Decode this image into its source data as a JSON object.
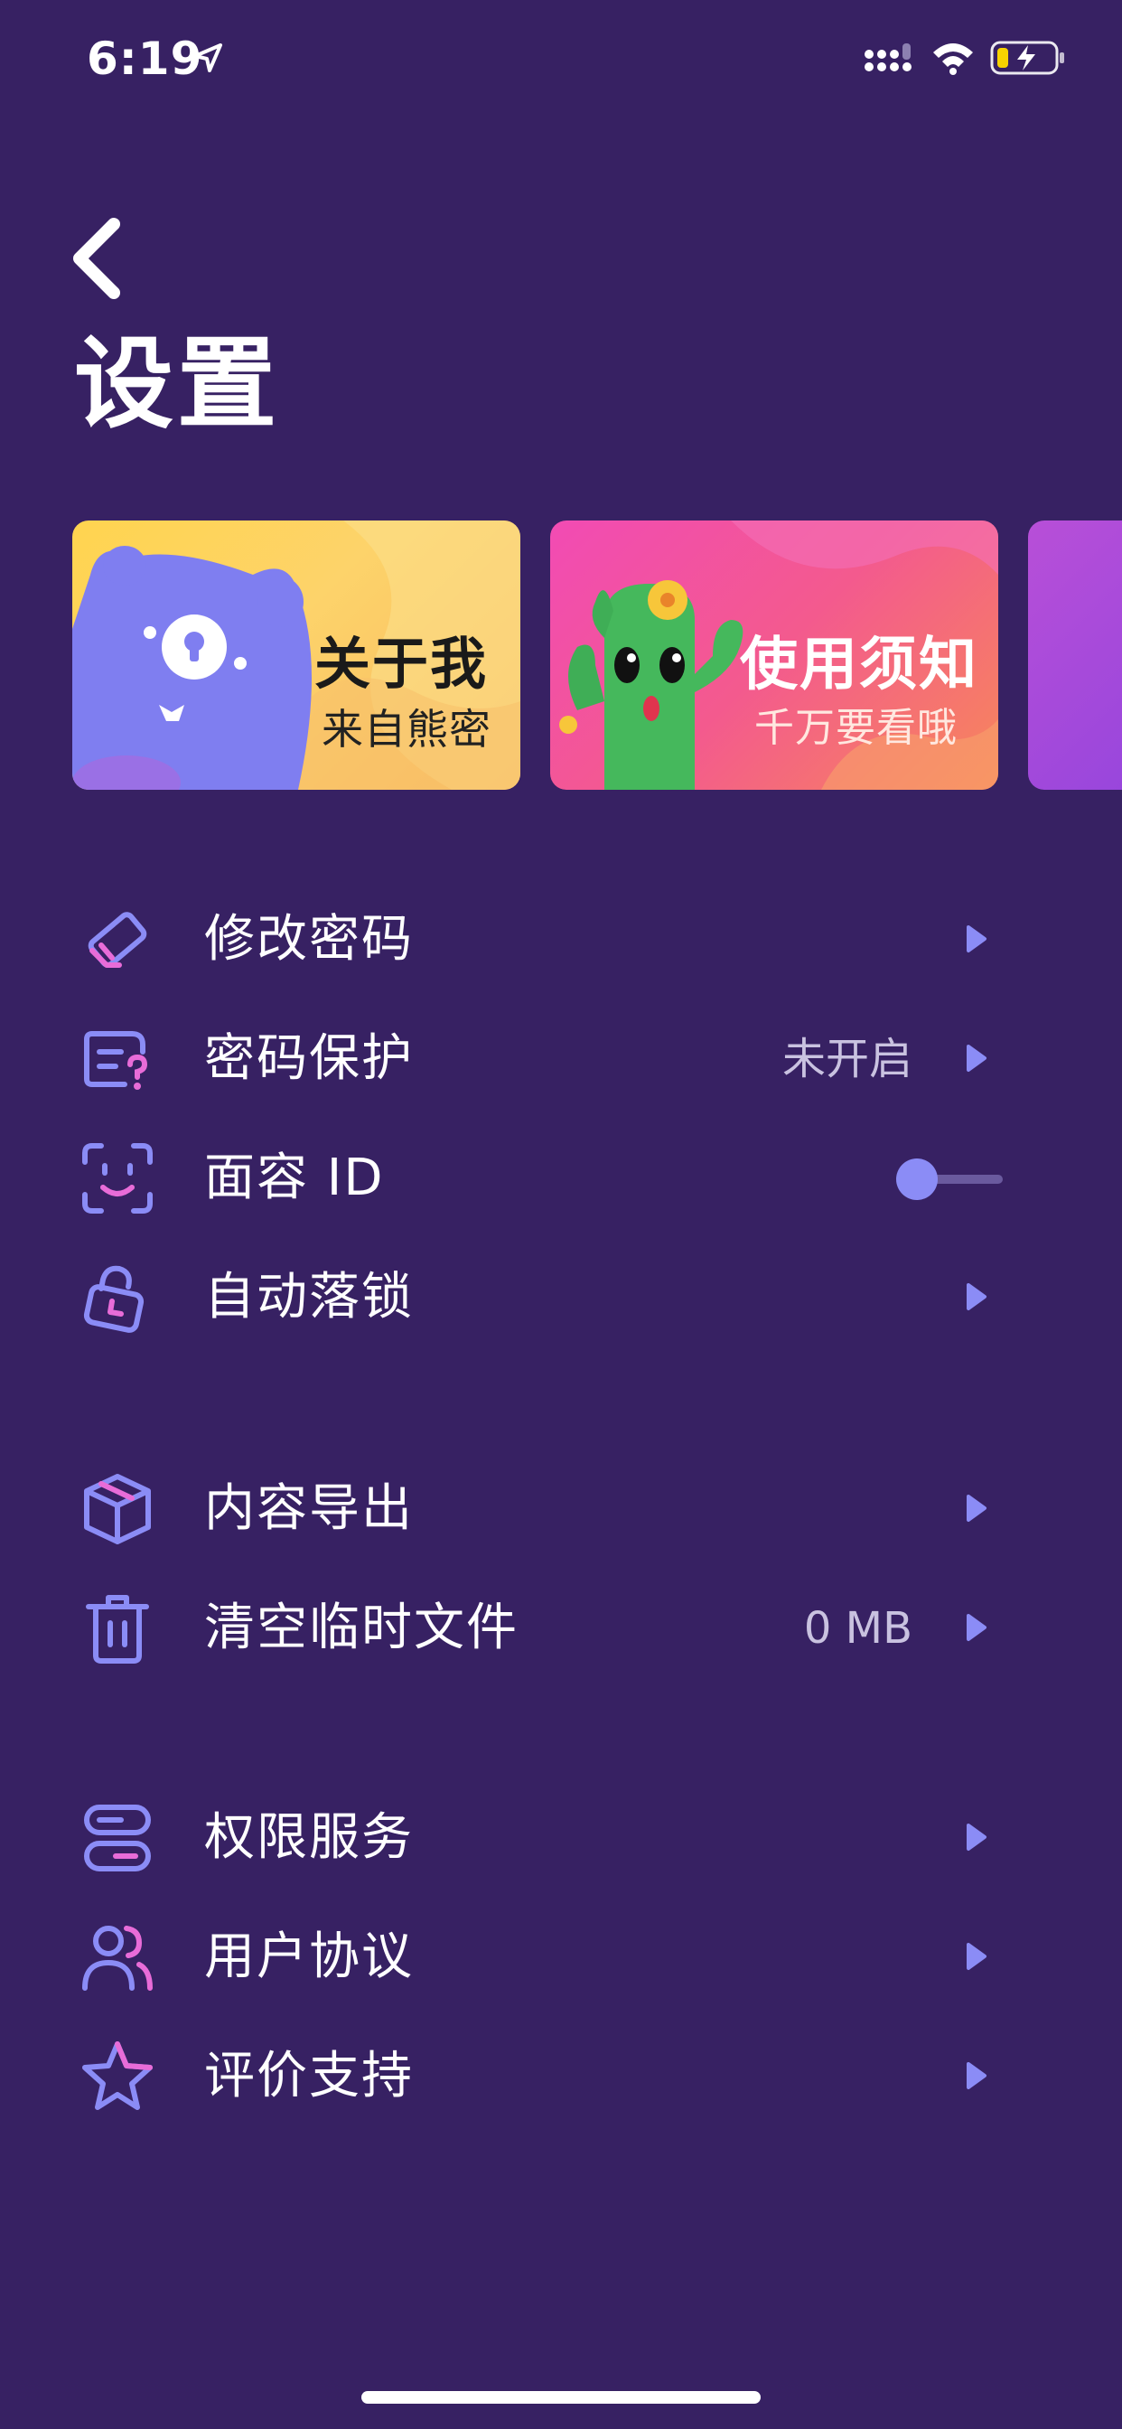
{
  "status_bar": {
    "time": "6:19"
  },
  "header": {
    "title": "设置"
  },
  "banners": [
    {
      "title": "关于我",
      "subtitle": "来自熊密"
    },
    {
      "title": "使用须知",
      "subtitle": "千万要看哦"
    }
  ],
  "groups": [
    {
      "items": [
        {
          "icon": "eraser-icon",
          "label": "修改密码",
          "value": ""
        },
        {
          "icon": "security-question-icon",
          "label": "密码保护",
          "value": "未开启"
        },
        {
          "icon": "face-id-icon",
          "label": "面容 ID",
          "toggle": false
        },
        {
          "icon": "lock-clock-icon",
          "label": "自动落锁",
          "value": ""
        }
      ]
    },
    {
      "items": [
        {
          "icon": "box-icon",
          "label": "内容导出",
          "value": ""
        },
        {
          "icon": "trash-icon",
          "label": "清空临时文件",
          "value": "0 MB"
        }
      ]
    },
    {
      "items": [
        {
          "icon": "toggles-icon",
          "label": "权限服务",
          "value": ""
        },
        {
          "icon": "users-icon",
          "label": "用户协议",
          "value": ""
        },
        {
          "icon": "star-icon",
          "label": "评价支持",
          "value": ""
        }
      ]
    }
  ],
  "colors": {
    "background": "#372163",
    "icon_blue": "#8b8cf6",
    "icon_pink": "#e86cd8",
    "chevron": "#8b8cf6",
    "value_text": "#c9c2e0"
  }
}
